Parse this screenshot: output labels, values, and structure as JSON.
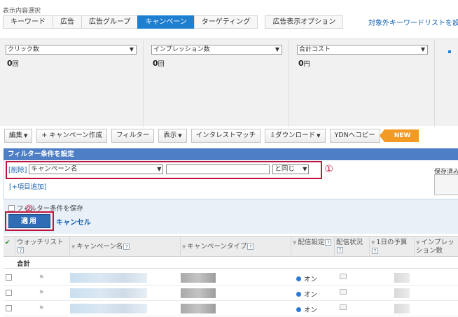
{
  "view_select_label": "表示内容選択",
  "tabs": [
    "キーワード",
    "広告",
    "広告グループ",
    "キャンペーン",
    "ターゲティング"
  ],
  "active_tab": "キャンペーン",
  "option_tab": "広告表示オプション",
  "negative_keyword_link": "対象外キーワードリストを設",
  "metrics": [
    {
      "label": "クリック数",
      "value": "0",
      "unit": "回"
    },
    {
      "label": "インプレッション数",
      "value": "0",
      "unit": "回"
    },
    {
      "label": "合計コスト",
      "value": "0",
      "unit": "円"
    }
  ],
  "toolbar": {
    "edit": "編集",
    "create_campaign": "キャンペーン作成",
    "filter": "フィルター",
    "display": "表示",
    "interest_match": "インタレストマッチ",
    "download": "ダウンロード",
    "copy_ydn": "YDNへコピー",
    "new_badge": "NEW"
  },
  "filter": {
    "header": "フィルター条件を設定",
    "delete_link": "[削除]",
    "field": "キャンペーン名",
    "value": "",
    "operator": "と同じ",
    "marker1": "①",
    "add_item": "[+項目追加]",
    "saved_label": "保存済み",
    "save_condition": "フィルター条件を保存",
    "apply": "適用",
    "cancel": "キャンセル",
    "marker2": "②"
  },
  "table": {
    "columns": [
      "ウォッチリスト",
      "キャンペーン名",
      "キャンペーンタイプ",
      "配信設定",
      "配信状況",
      "1日の予算",
      "インプレッション数"
    ],
    "total_label": "合計",
    "rows": [
      {
        "status": "オン"
      },
      {
        "status": "オン"
      },
      {
        "status": "オン"
      }
    ]
  },
  "colors": {
    "accent": "#1e7fd1",
    "highlight": "#c0143c",
    "new_badge": "#f39a25"
  }
}
